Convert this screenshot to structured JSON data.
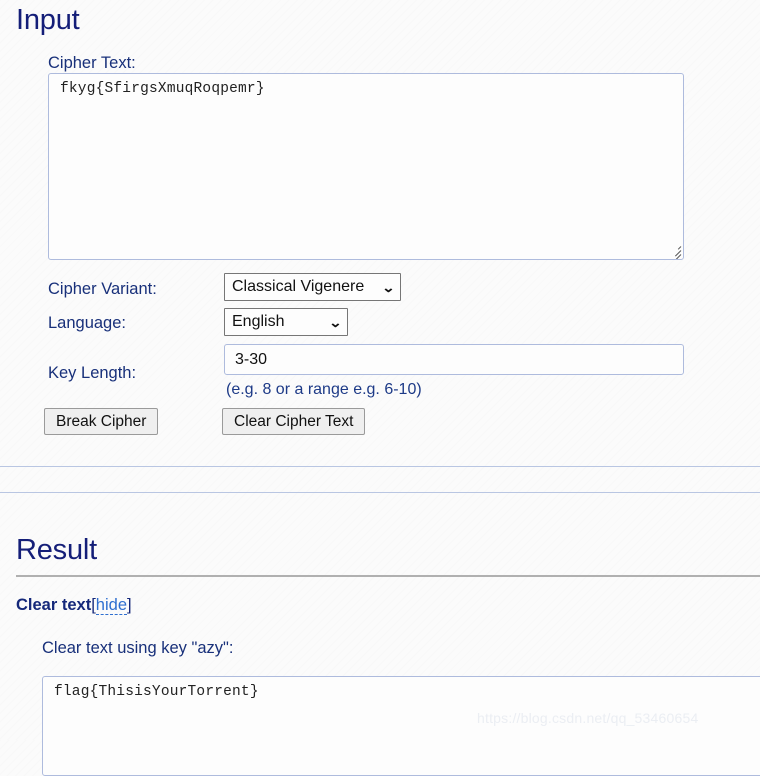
{
  "input_section": {
    "title": "Input",
    "cipher_text_label": "Cipher Text:",
    "cipher_text_value": "fkyg{SfirgsXmuqRoqpemr}",
    "cipher_variant_label": "Cipher Variant:",
    "cipher_variant_value": "Classical Vigenere",
    "language_label": "Language:",
    "language_value": "English",
    "key_length_label": "Key Length:",
    "key_length_value": "3-30",
    "key_length_hint": "(e.g. 8 or a range e.g. 6-10)",
    "break_button_label": "Break Cipher",
    "clear_button_label": "Clear Cipher Text",
    "chevron_glyph": "⌄"
  },
  "result_section": {
    "title": "Result",
    "cleartext_label": "Clear text",
    "bracket_open": "[",
    "hide_link_label": "hide",
    "bracket_close": "]",
    "cleartext_key_line": "Clear text using key \"azy\":",
    "result_value": "flag{ThisisYourTorrent}"
  },
  "watermark": {
    "text": "https://blog.csdn.net/qq_53460654"
  },
  "colors": {
    "heading": "#141e78",
    "label": "#18307a",
    "link": "#2f6fd0",
    "field_border": "#aebbdd",
    "divider": "#b9c6e2",
    "button_bg": "#efefef"
  }
}
